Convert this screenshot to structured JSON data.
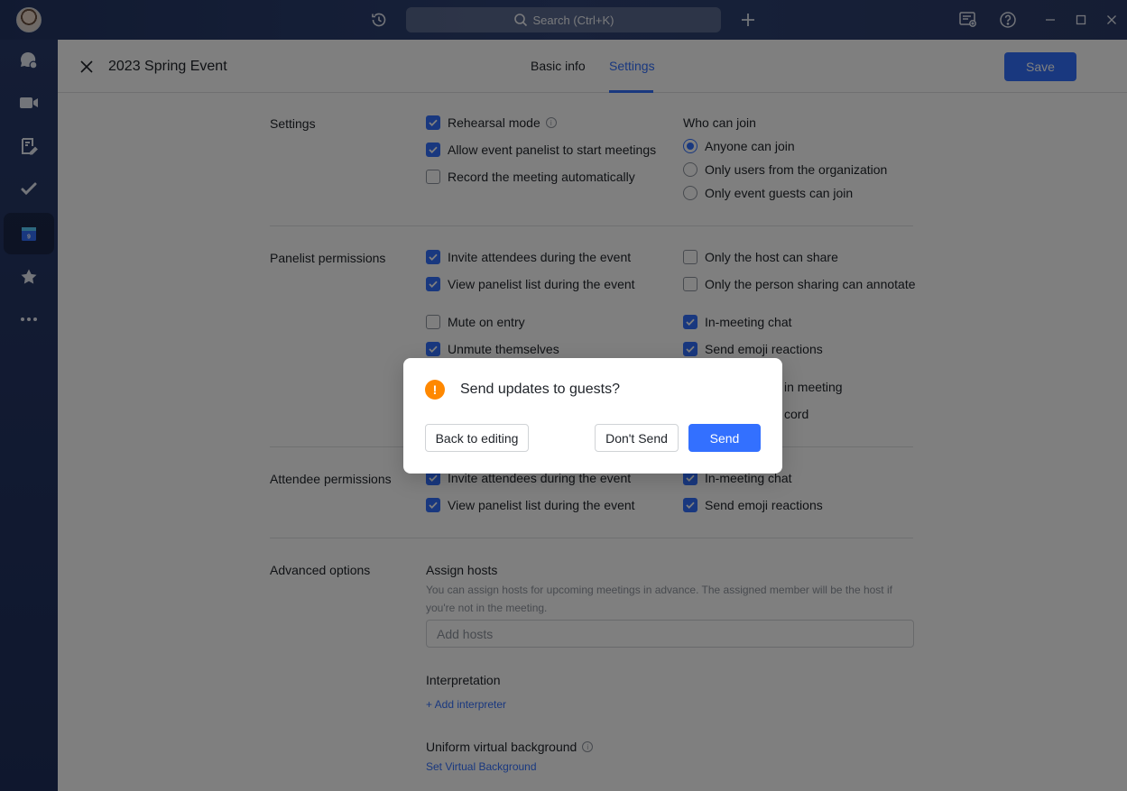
{
  "titlebar": {
    "search_label": "Search (Ctrl+K)"
  },
  "rail": {
    "items": [
      {
        "icon": "chat-icon"
      },
      {
        "icon": "video-icon"
      },
      {
        "icon": "docs-icon"
      },
      {
        "icon": "tasks-icon"
      },
      {
        "icon": "calendar-icon",
        "active": true,
        "badge": "9"
      },
      {
        "icon": "star-icon"
      },
      {
        "icon": "more-icon"
      }
    ]
  },
  "header": {
    "title": "2023 Spring Event",
    "tabs": [
      {
        "label": "Basic info",
        "active": false
      },
      {
        "label": "Settings",
        "active": true
      }
    ],
    "save_label": "Save"
  },
  "settings": {
    "label": "Settings",
    "options": [
      {
        "label": "Rehearsal mode",
        "checked": true,
        "info": true
      },
      {
        "label": "Allow event panelist to start meetings",
        "checked": true
      },
      {
        "label": "Record the meeting automatically",
        "checked": false
      }
    ],
    "who_can_join": {
      "title": "Who can join",
      "options": [
        {
          "label": "Anyone can join",
          "selected": true
        },
        {
          "label": "Only users from the organization",
          "selected": false
        },
        {
          "label": "Only event guests can join",
          "selected": false
        }
      ]
    }
  },
  "panelist": {
    "label": "Panelist permissions",
    "left": [
      {
        "label": "Invite attendees during the event",
        "checked": true
      },
      {
        "label": "View panelist list during the event",
        "checked": true
      },
      {
        "label": "Mute on entry",
        "checked": false
      },
      {
        "label": "Unmute themselves",
        "checked": true
      }
    ],
    "right": [
      {
        "label": "Only the host can share",
        "checked": false
      },
      {
        "label": "Only the person sharing can annotate",
        "checked": false
      },
      {
        "label": "In-meeting chat",
        "checked": true
      },
      {
        "label": "Send emoji reactions",
        "checked": true
      }
    ],
    "obscured_fragments": [
      "in meeting",
      "cord"
    ]
  },
  "attendee": {
    "label": "Attendee permissions",
    "left": [
      {
        "label": "Invite attendees during the event",
        "checked": true
      },
      {
        "label": "View panelist list during the event",
        "checked": true
      }
    ],
    "right": [
      {
        "label": "In-meeting chat",
        "checked": true
      },
      {
        "label": "Send emoji reactions",
        "checked": true
      }
    ]
  },
  "advanced": {
    "label": "Advanced options",
    "assign_hosts": {
      "title": "Assign hosts",
      "hint": "You can assign hosts for upcoming meetings in advance. The assigned member will be the host if you're not in the meeting.",
      "placeholder": "Add hosts"
    },
    "interpretation": {
      "title": "Interpretation",
      "add_label": "+ Add interpreter"
    },
    "virtual_background": {
      "title": "Uniform virtual background",
      "link": "Set Virtual Background"
    }
  },
  "dialog": {
    "title": "Send updates to guests?",
    "back_label": "Back to editing",
    "dont_send_label": "Don't Send",
    "send_label": "Send"
  },
  "colors": {
    "accent": "#3370ff",
    "warning": "#ff8800",
    "sidebar": "#233563"
  }
}
